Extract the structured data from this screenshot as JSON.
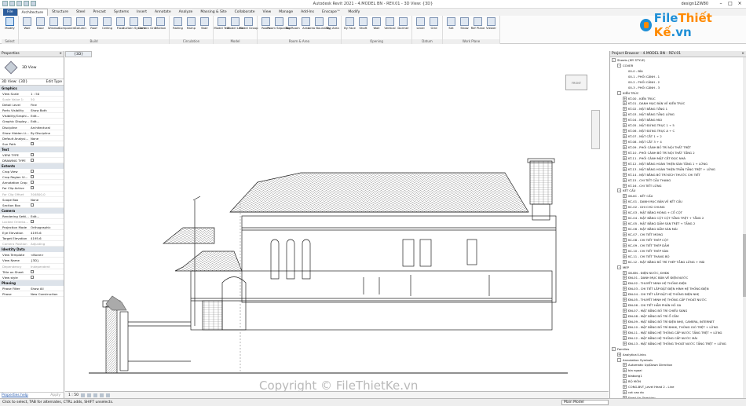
{
  "window": {
    "title": "Autodesk Revit 2021 - 4.MODEL BN - REV.01 - 3D View: {3D}",
    "user": "design1ZW80"
  },
  "ribbon": {
    "tabs": [
      "File",
      "Architecture",
      "Structure",
      "Steel",
      "Precast",
      "Systems",
      "Insert",
      "Annotate",
      "Analyze",
      "Massing & Site",
      "Collaborate",
      "View",
      "Manage",
      "Add-Ins",
      "Enscape™",
      "Modify"
    ],
    "groups": [
      {
        "label": "Select",
        "tools": [
          "Modify"
        ]
      },
      {
        "label": "Build",
        "tools": [
          "Wall",
          "Door",
          "Window",
          "Component",
          "Column",
          "Roof",
          "Ceiling",
          "Floor",
          "Curtain System",
          "Curtain Grid",
          "Mullion"
        ]
      },
      {
        "label": "Circulation",
        "tools": [
          "Railing",
          "Ramp",
          "Stair"
        ]
      },
      {
        "label": "Model",
        "tools": [
          "Model Text",
          "Model Line",
          "Model Group"
        ]
      },
      {
        "label": "Room & Area",
        "tools": [
          "Room",
          "Room Separator",
          "Tag Room",
          "Area",
          "Area Boundary",
          "Tag Area"
        ]
      },
      {
        "label": "Opening",
        "tools": [
          "By Face",
          "Shaft",
          "Wall",
          "Vertical",
          "Dormer"
        ]
      },
      {
        "label": "Datum",
        "tools": [
          "Level",
          "Grid"
        ]
      },
      {
        "label": "Work Plane",
        "tools": [
          "Set",
          "Show",
          "Ref Plane",
          "Viewer"
        ]
      }
    ]
  },
  "properties": {
    "title": "Properties",
    "type_name": "3D View",
    "filter": "3D View: {3D}",
    "edit_type": "Edit Type",
    "sections": [
      {
        "name": "Graphics",
        "rows": [
          [
            "View Scale",
            "1 : 50"
          ],
          [
            "Scale Value 1:",
            "50"
          ],
          [
            "Detail Level",
            "Fine"
          ],
          [
            "Parts Visibility",
            "Show Both"
          ],
          [
            "Visibility/Graphi...",
            "Edit..."
          ],
          [
            "Graphic Display...",
            "Edit..."
          ],
          [
            "Discipline",
            "Architectural"
          ],
          [
            "Show Hidden Li...",
            "By Discipline"
          ],
          [
            "Default Analysi...",
            "None"
          ],
          [
            "Sun Path",
            ""
          ]
        ]
      },
      {
        "name": "Text",
        "rows": [
          [
            "VIEW TYPE",
            ""
          ],
          [
            "DRAWING TYPE",
            ""
          ]
        ]
      },
      {
        "name": "Extents",
        "rows": [
          [
            "Crop View",
            ""
          ],
          [
            "Crop Region Vi...",
            ""
          ],
          [
            "Annotation Crop",
            ""
          ],
          [
            "Far Clip Active",
            ""
          ],
          [
            "Far Clip Offset",
            "304800.0"
          ],
          [
            "Scope Box",
            "None"
          ],
          [
            "Section Box",
            ""
          ]
        ]
      },
      {
        "name": "Camera",
        "rows": [
          [
            "Rendering Setti...",
            "Edit..."
          ],
          [
            "Locked Orienta...",
            ""
          ],
          [
            "Projection Mode",
            "Orthographic"
          ],
          [
            "Eye Elevation",
            "4195.6"
          ],
          [
            "Target Elevation",
            "4195.6"
          ],
          [
            "Camera Position",
            "Adjusting"
          ]
        ]
      },
      {
        "name": "Identity Data",
        "rows": [
          [
            "View Template",
            "<None>"
          ],
          [
            "View Name",
            "{3D}"
          ],
          [
            "Dependency",
            "Independent"
          ],
          [
            "Title on Sheet",
            ""
          ],
          [
            "View style",
            ""
          ]
        ]
      },
      {
        "name": "Phasing",
        "rows": [
          [
            "Phase Filter",
            "Show All"
          ],
          [
            "Phase",
            "New Construction"
          ]
        ]
      }
    ],
    "help_link": "Properties help",
    "apply": "Apply"
  },
  "view": {
    "tab": "{3D}",
    "cube_label": "FRONT",
    "scale": "1 : 50"
  },
  "browser": {
    "title": "Project Browser - 4.MODEL BN - REV.01",
    "items": [
      [
        "-",
        "Sheets (MY STYLE)",
        0
      ],
      [
        "-",
        "COVER",
        1
      ],
      [
        "",
        "00-0 - BÌA",
        2
      ],
      [
        "",
        "00-1 - PHỐI CẢNH - 1",
        2
      ],
      [
        "",
        "00-2 - PHỐI CẢNH - 2",
        2
      ],
      [
        "",
        "00-3 - PHỐI CẢNH - 3",
        2
      ],
      [
        "-",
        "KIẾN TRÚC",
        1
      ],
      [
        "+",
        "KT-00 - KIẾN TRÚC",
        2
      ],
      [
        "+",
        "KT-01 - DANH MỤC BẢN VẼ KIẾN TRÚC",
        2
      ],
      [
        "+",
        "KT-02 - MẶT BẰNG TẦNG 1",
        2
      ],
      [
        "+",
        "KT-03 - MẶT BẰNG TẦNG LỬNG",
        2
      ],
      [
        "+",
        "KT-04 - MẶT BẰNG MÁI",
        2
      ],
      [
        "+",
        "KT-05 - MẶT ĐỨNG TRỤC 1 ÷ 5",
        2
      ],
      [
        "+",
        "KT-06 - MẶT ĐỨNG TRỤC A ÷ C",
        2
      ],
      [
        "+",
        "KT-07 - MẶT CẮT 1 ÷ 2",
        2
      ],
      [
        "+",
        "KT-08 - MẶT CẮT 3 ÷ 4",
        2
      ],
      [
        "+",
        "KT-09 - PHỐI CẢNH BỐ TRÍ NỘI THẤT TRỆT",
        2
      ],
      [
        "+",
        "KT-10 - PHỐI CẢNH BỐ TRÍ NỘI THẤT TẦNG 2",
        2
      ],
      [
        "+",
        "KT-11 - PHỐI CẢNH MẶT CẮT ĐỌC NHÀ",
        2
      ],
      [
        "+",
        "KT-12 - MẶT BẰNG HOÀN THIỆN SÀN TẦNG 1 + LỬNG",
        2
      ],
      [
        "+",
        "KT-13 - MẶT BẰNG HOÀN THIỆN TRẦN TẦNG TRỆT + LỬNG",
        2
      ],
      [
        "+",
        "KT-14 - MẶT BẰNG BỐ TRÍ KÍCH THƯỚC CHI TIẾT",
        2
      ],
      [
        "+",
        "KT-15 - CHI TIẾT CẦU THANG",
        2
      ],
      [
        "+",
        "KT-16 - CHI TIẾT LỬNG",
        2
      ],
      [
        "-",
        "KẾT CẤU",
        1
      ],
      [
        "+",
        "08-KC - KẾT CẤU",
        2
      ],
      [
        "+",
        "KC-01 - DANH MỤC BẢN VẼ KẾT CẤU",
        2
      ],
      [
        "+",
        "KC-02 - GHI CHÚ CHUNG",
        2
      ],
      [
        "+",
        "KC-03 - MẶT BẰNG MÓNG + CỔ CỘT",
        2
      ],
      [
        "+",
        "KC-04 - MẶT BẰNG CỘT CỘT TẦNG TRỆT + TẦNG 2",
        2
      ],
      [
        "+",
        "KC-05 - MẶT BẰNG DẦM SÀN TRỆT + TẦNG 2",
        2
      ],
      [
        "+",
        "KC-06 - MẶT BẰNG DẦM SÀN MÁI",
        2
      ],
      [
        "+",
        "KC-07 - CHI TIẾT MÓNG",
        2
      ],
      [
        "+",
        "KC-08 - CHI TIẾT THÉP CỘT",
        2
      ],
      [
        "+",
        "KC-09 - CHI TIẾT THÉP DẦM",
        2
      ],
      [
        "+",
        "KC-10 - CHI TIẾT THÉP SÀN",
        2
      ],
      [
        "+",
        "KC-11 - CHI TIẾT THANG BỘ",
        2
      ],
      [
        "+",
        "KC-12 - MẶT BẰNG BỐ TRÍ THÉP TẦNG LỬNG + MÁI",
        2
      ],
      [
        "-",
        "MEP",
        1
      ],
      [
        "+",
        "08-ĐN - ĐIỆN NƯỚC, ĐHĐK",
        2
      ],
      [
        "+",
        "ĐN-01 - DANH MỤC BẢN VẼ ĐIỆN NƯỚC",
        2
      ],
      [
        "+",
        "ĐN-02 - THUYẾT MINH HỆ THỐNG ĐIỆN",
        2
      ],
      [
        "+",
        "ĐN-03 - CHI TIẾT LẮP ĐẶT ĐIỆN HÌNH HỆ THỐNG ĐIỆN",
        2
      ],
      [
        "+",
        "ĐN-04 - CHI TIẾT LẮP ĐẶT HỆ THỐNG ĐIỆN NHẸ",
        2
      ],
      [
        "+",
        "ĐN-05 - THUYẾT MINH HỆ THỐNG CẤP THOÁT NƯỚC",
        2
      ],
      [
        "+",
        "ĐN-06 - CHI TIẾT HẦM PHÂN HỐ GA",
        2
      ],
      [
        "+",
        "ĐN-07 - MẶT BẰNG BỐ TRÍ CHIẾU SÁNG",
        2
      ],
      [
        "+",
        "ĐN-08 - MẶT BẰNG BỐ TRÍ Ổ CẮM",
        2
      ],
      [
        "+",
        "ĐN-09 - MẶT BẰNG BỐ TRÍ ĐIỆN NHẸ, CAMERA, INTERNET",
        2
      ],
      [
        "+",
        "ĐN-10 - MẶT BẰNG BỐ TRÍ ĐHKK, THÔNG GIÓ TRỆT + LỬNG",
        2
      ],
      [
        "+",
        "ĐN-11 - MẶT BẰNG HỆ THỐNG CẤP NƯỚC TẦNG TRỆT + LỬNG",
        2
      ],
      [
        "+",
        "ĐN-12 - MẶT BẰNG HỆ THỐNG CẤP NƯỚC MÁI",
        2
      ],
      [
        "+",
        "ĐN-13 - MẶT BẰNG HỆ THỐNG THOÁT NƯỚC TẦNG TRỆT + LỬNG",
        2
      ],
      [
        "-",
        "Families",
        0
      ],
      [
        "+",
        "Analytical Links",
        1
      ],
      [
        "-",
        "Annotation Symbols",
        1
      ],
      [
        "+",
        "Automatic Up/Down Direction",
        2
      ],
      [
        "+",
        "bia ngoai",
        2
      ],
      [
        "+",
        "blabong1",
        2
      ],
      [
        "+",
        "BỘ MÔN",
        2
      ],
      [
        "+",
        "CONG-BVT_Level Head 2 - Line",
        2
      ],
      [
        "+",
        "cot cao do",
        2
      ],
      [
        "+",
        "Fixed Up Direction",
        2
      ],
      [
        "+",
        "GHI CHÚ A4",
        2
      ]
    ]
  },
  "status": {
    "text": "Click to select, TAB for alternates, CTRL adds, SHIFT unselects.",
    "model": "Main Model"
  },
  "watermark": {
    "brand_main": "File",
    "brand_accent": "Thiết Kế",
    "brand_tld": ".vn",
    "copyright": "Copyright © FileThietKe.vn"
  }
}
